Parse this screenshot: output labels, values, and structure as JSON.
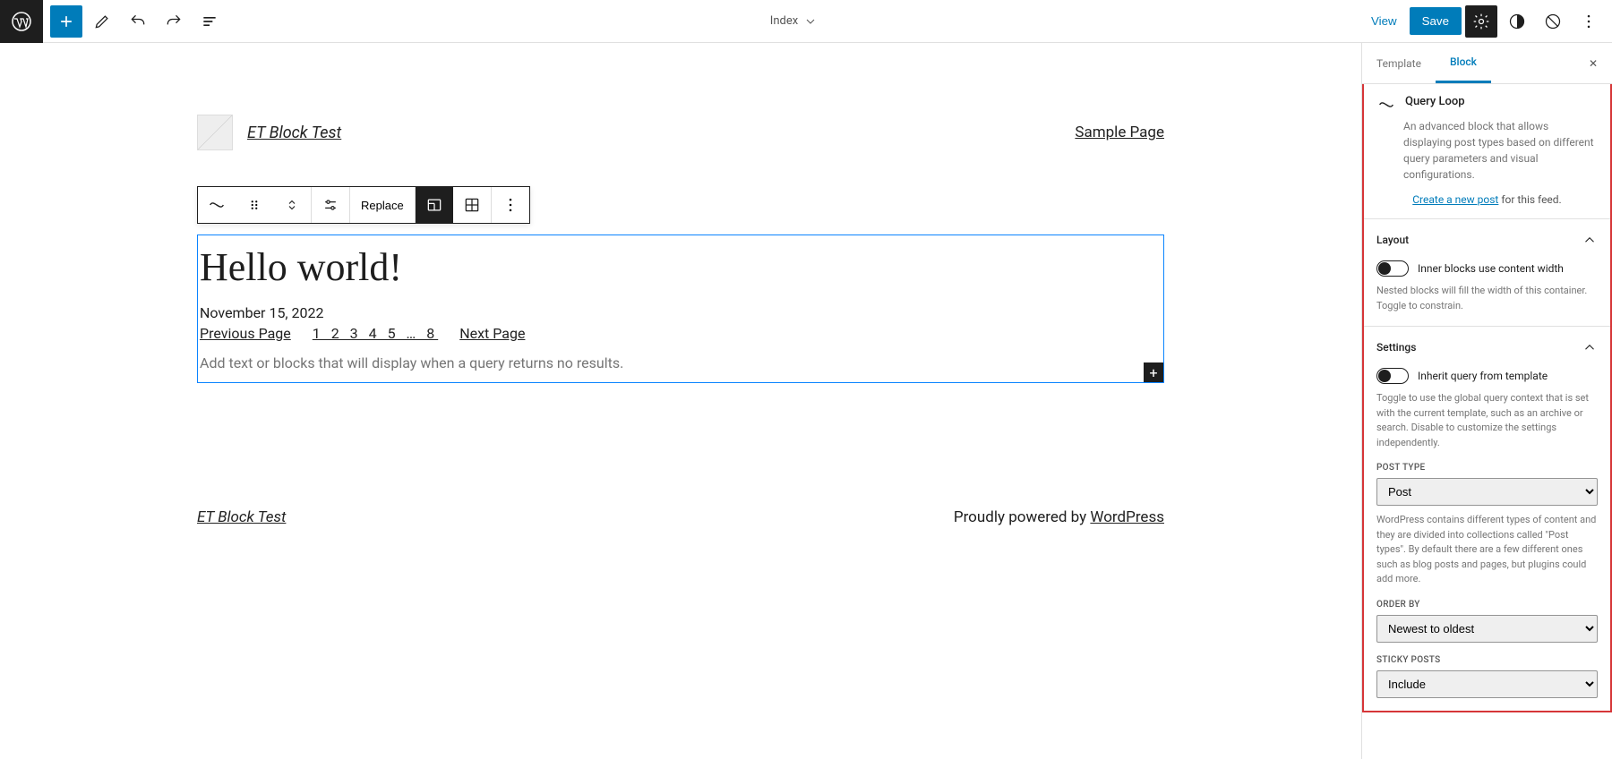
{
  "topbar": {
    "document_title": "Index",
    "view_label": "View",
    "save_label": "Save"
  },
  "canvas": {
    "site_title": "ET Block Test",
    "nav_link": "Sample Page",
    "toolbar_replace": "Replace",
    "post_title": "Hello world!",
    "post_date": "November 15, 2022",
    "pagination": {
      "prev": "Previous Page",
      "numbers": "1 2 3 4 5 … 8",
      "next": "Next Page"
    },
    "no_results_placeholder": "Add text or blocks that will display when a query returns no results.",
    "footer_site": "ET Block Test",
    "footer_powered": "Proudly powered by ",
    "footer_wp": "WordPress"
  },
  "sidebar": {
    "tabs": {
      "template": "Template",
      "block": "Block"
    },
    "block_name": "Query Loop",
    "block_desc": "An advanced block that allows displaying post types based on different query parameters and visual configurations.",
    "create_link": "Create a new post",
    "create_suffix": " for this feed.",
    "panels": {
      "layout": {
        "title": "Layout",
        "toggle_label": "Inner blocks use content width",
        "help": "Nested blocks will fill the width of this container. Toggle to constrain."
      },
      "settings": {
        "title": "Settings",
        "toggle_label": "Inherit query from template",
        "help": "Toggle to use the global query context that is set with the current template, such as an archive or search. Disable to customize the settings independently.",
        "post_type_label": "POST TYPE",
        "post_type_value": "Post",
        "post_type_help": "WordPress contains different types of content and they are divided into collections called \"Post types\". By default there are a few different ones such as blog posts and pages, but plugins could add more.",
        "order_by_label": "ORDER BY",
        "order_by_value": "Newest to oldest",
        "sticky_label": "STICKY POSTS",
        "sticky_value": "Include"
      }
    }
  }
}
